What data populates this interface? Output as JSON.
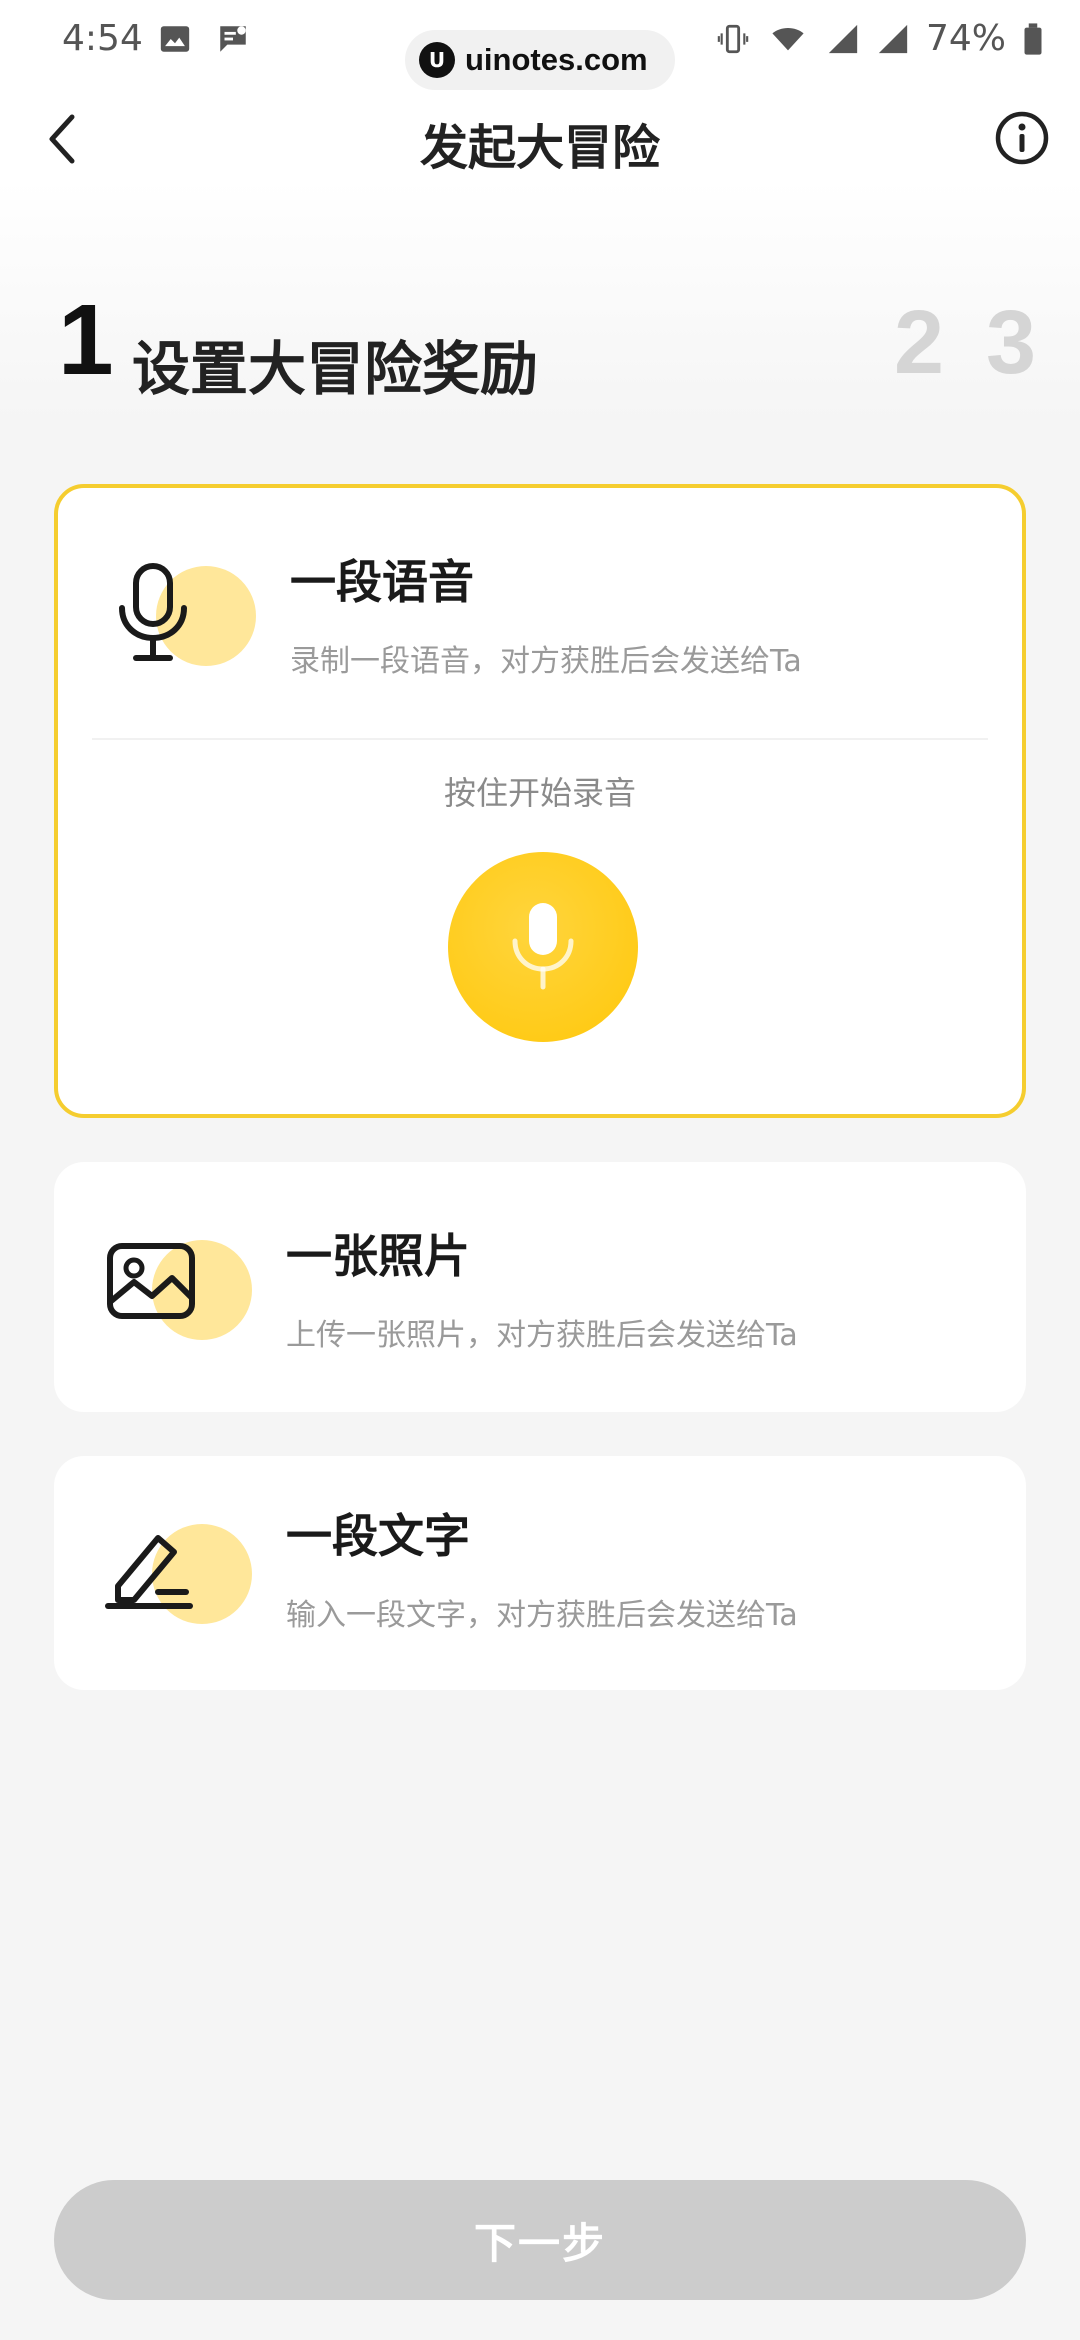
{
  "status_bar": {
    "time": "4:54",
    "battery": "74%",
    "icons": [
      "image-icon",
      "message-icon",
      "vibrate-icon",
      "wifi-icon",
      "signal-icon",
      "signal-icon",
      "battery-icon"
    ]
  },
  "watermark": {
    "logo": "U",
    "text": "uinotes.com"
  },
  "header": {
    "title": "发起大冒险",
    "back_icon": "chevron-left-icon",
    "info_icon": "info-icon"
  },
  "steps": {
    "current_number": "1",
    "current_label": "设置大冒险奖励",
    "next_numbers": [
      "2",
      "3"
    ]
  },
  "options": [
    {
      "title": "一段语音",
      "desc": "录制一段语音，对方获胜后会发送给Ta",
      "icon": "microphone-icon",
      "selected": true,
      "record_hint": "按住开始录音"
    },
    {
      "title": "一张照片",
      "desc": "上传一张照片，对方获胜后会发送给Ta",
      "icon": "image-icon",
      "selected": false
    },
    {
      "title": "一段文字",
      "desc": "输入一段文字，对方获胜后会发送给Ta",
      "icon": "edit-icon",
      "selected": false
    }
  ],
  "next_button": {
    "label": "下一步",
    "enabled": false
  },
  "colors": {
    "accent": "#FFC70A",
    "accent_border": "#F5CD2F",
    "icon_blob": "#FFE79A",
    "disabled_button": "#CCCCCC",
    "muted_text": "#9A9A9A",
    "step_inactive": "#D5D5D5"
  }
}
